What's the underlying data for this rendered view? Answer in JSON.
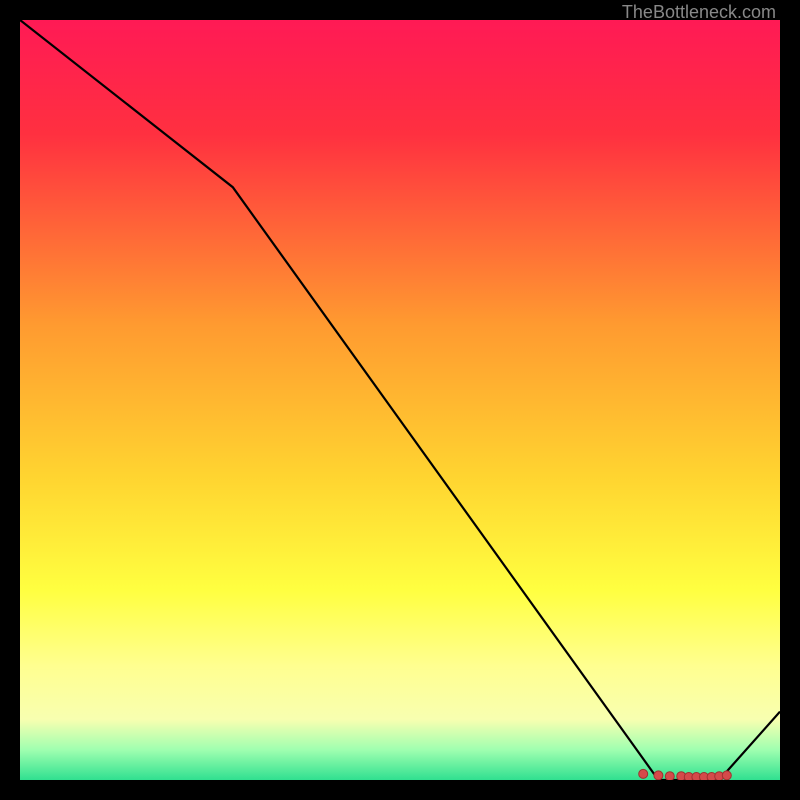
{
  "watermark": "TheBottleneck.com",
  "chart_data": {
    "type": "line",
    "title": "",
    "xlabel": "",
    "ylabel": "",
    "xlim": [
      0,
      100
    ],
    "ylim": [
      0,
      100
    ],
    "series": [
      {
        "name": "curve",
        "x": [
          0,
          28,
          84,
          92,
          100
        ],
        "y": [
          100,
          78,
          0,
          0,
          9
        ]
      }
    ],
    "markers": {
      "name": "points",
      "x": [
        82,
        84,
        85.5,
        87,
        88,
        89,
        90,
        91,
        92,
        93
      ],
      "y": [
        0.8,
        0.6,
        0.5,
        0.5,
        0.4,
        0.4,
        0.4,
        0.4,
        0.5,
        0.6
      ]
    },
    "gradient_stops": [
      {
        "offset": 0,
        "color": "#ff1a55"
      },
      {
        "offset": 15,
        "color": "#ff3040"
      },
      {
        "offset": 40,
        "color": "#ff9a30"
      },
      {
        "offset": 60,
        "color": "#ffd430"
      },
      {
        "offset": 75,
        "color": "#ffff40"
      },
      {
        "offset": 85,
        "color": "#ffff90"
      },
      {
        "offset": 92,
        "color": "#f8ffb0"
      },
      {
        "offset": 96,
        "color": "#a0ffb0"
      },
      {
        "offset": 100,
        "color": "#30e090"
      }
    ]
  }
}
